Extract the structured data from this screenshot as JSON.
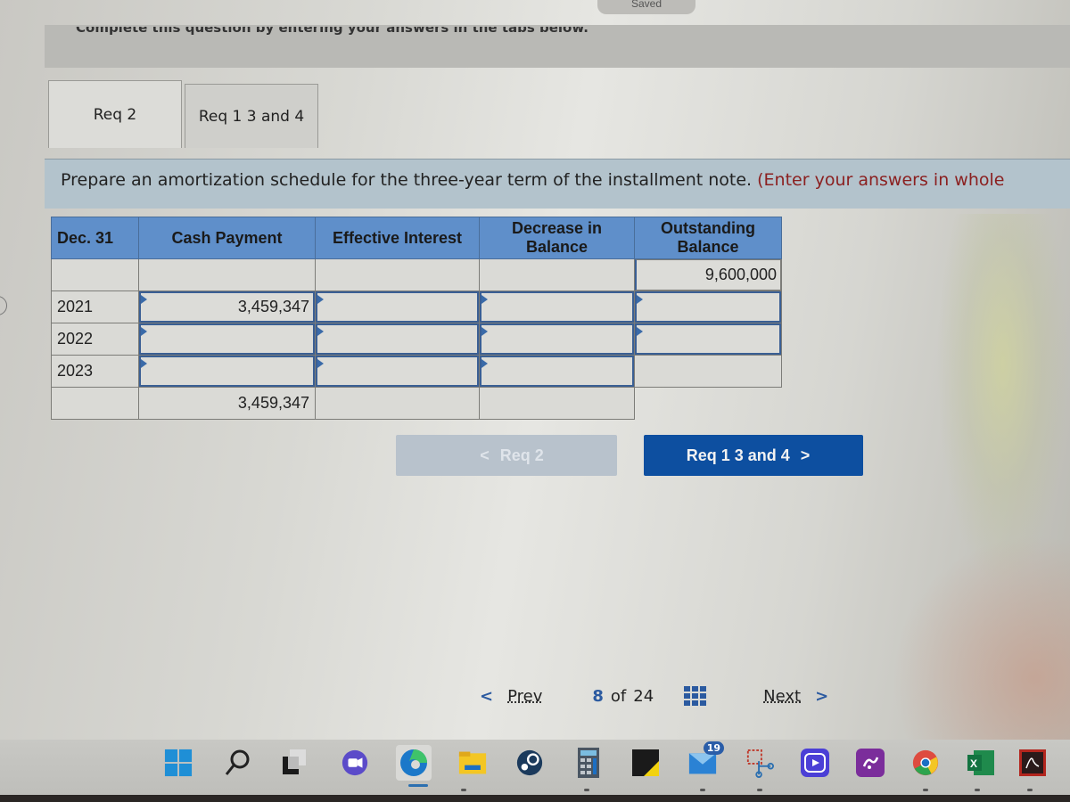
{
  "header": {
    "saved_label": "Saved",
    "instruction": "Complete this question by entering your answers in the tabs below."
  },
  "tabs": [
    {
      "label": "Req 2",
      "active": true
    },
    {
      "label": "Req 1 3 and 4",
      "active": false
    }
  ],
  "prompt": {
    "text": "Prepare an amortization schedule for the three-year term of the installment note. ",
    "hint": "(Enter your answers in whole"
  },
  "table": {
    "headers": {
      "date": "Dec. 31",
      "cash": "Cash Payment",
      "interest": "Effective Interest",
      "decrease_line1": "Decrease in",
      "decrease_line2": "Balance",
      "balance_line1": "Outstanding",
      "balance_line2": "Balance"
    },
    "opening_balance": "9,600,000",
    "rows": [
      {
        "year": "2021",
        "cash": "3,459,347",
        "interest": "",
        "decrease": "",
        "balance": ""
      },
      {
        "year": "2022",
        "cash": "",
        "interest": "",
        "decrease": "",
        "balance": ""
      },
      {
        "year": "2023",
        "cash": "",
        "interest": "",
        "decrease": "",
        "balance": ""
      }
    ],
    "total": {
      "cash": "3,459,347",
      "interest": "",
      "decrease": ""
    }
  },
  "nav_buttons": {
    "prev_label": "Req 2",
    "next_label": "Req 1 3 and 4",
    "prev_chevron": "<",
    "next_chevron": ">"
  },
  "pager": {
    "prev_label": "Prev",
    "current": "8",
    "of_label": "of",
    "total": "24",
    "next_label": "Next",
    "prev_chevron": "<",
    "next_chevron": ">"
  },
  "taskbar": {
    "mail_badge": "19",
    "icons": [
      "windows-start",
      "search",
      "task-view",
      "chat",
      "edge",
      "file-explorer",
      "steam",
      "calculator",
      "sticky-app",
      "mail",
      "snipping-tool",
      "clipchamp",
      "splashtop",
      "chrome",
      "excel",
      "acrobat"
    ]
  },
  "colors": {
    "header_blue": "#5f8fca",
    "next_button": "#0d4fa0",
    "prompt_bar": "#b3c3cc",
    "hint_red": "#8b2020"
  }
}
